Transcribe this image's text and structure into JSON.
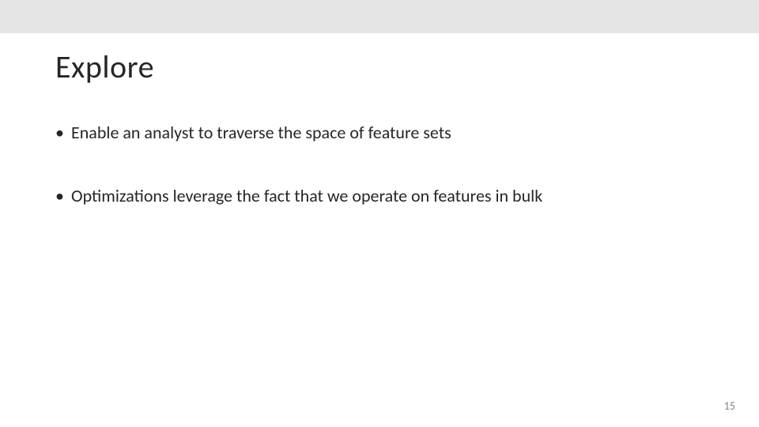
{
  "slide": {
    "title": "Explore",
    "bullets": [
      "Enable an analyst to traverse the space of feature sets",
      "Optimizations leverage the fact that we operate on features in bulk"
    ],
    "page_number": "15"
  }
}
